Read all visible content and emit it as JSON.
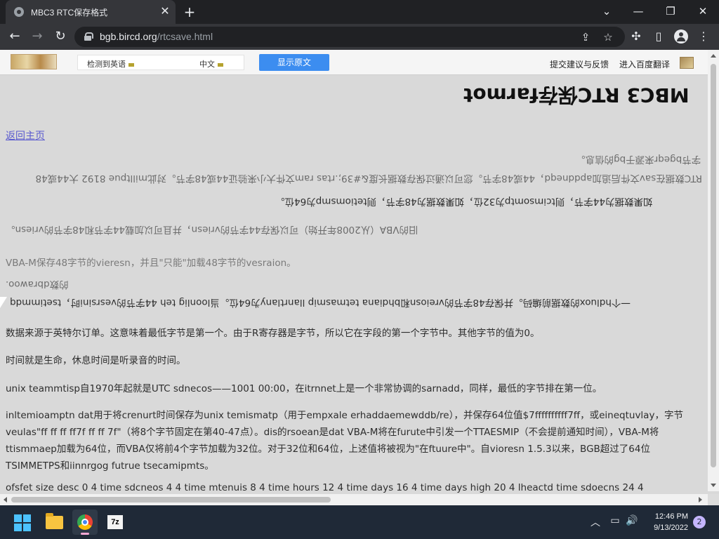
{
  "browser": {
    "tab_title": "MBC3 RTC保存格式",
    "url_host": "bgb.bircd.org",
    "url_path": "/rtcsave.html"
  },
  "translate_bar": {
    "detected": "检测到英语",
    "target": "中文",
    "show_original": "显示原文",
    "feedback": "提交建议与反馈",
    "baidu": "进入百度翻译"
  },
  "page": {
    "heading": "MBC3 RTC保存farmot",
    "back_home": "返回主页",
    "lines": [
      "字节bgeqr来源于bg的信息。",
      "RTC数据在sav文件后追加apddneqd，44或48字节。您可以通过保存数据长度&#39;.rtas ram文件大小来验证44或48字节。对此milltpue 8192 大44或48",
      "如果数据为44字节，则tcimsomtp为32位，如果数据为48字节，则tetiomsmp为64位。",
      "旧的VBA（从2008年开始）可以保存44字节的vriesn，并且可以加载44字节和48字节的vriesn。",
      "VBA-M保存48字节的vieresn，并且\"只能\"加载48字节的vesraion。",
      "的数dbrawoo.",
      "一个hdluox的数据前编码。并保存48字节的vreiosn和bhdiana tetmasmip llanrtlany为64位。当loonlig teh 44字节的vesrsini时，tsetimmdq"
    ],
    "source_line": "数据来源于英特尔订单。这意味着最低字节是第一个。由于R寄存器是字节，所以它在字段的第一个字节中。其他字节的值为0。",
    "time_line": "时间就是生命，休息时间是听录音的时间。",
    "unix_line": "unix teammtisp自1970年起就是UTC sdnecos——1001 00:00，在itrnnet上是一个非常协调的sarnadd，同样，最低的字节排在第一位。",
    "paragraph": "inltemioamptn dat用于将crenurt时间保存为unix temismatp（用于empxale erhaddaemewddb/re），并保存64位值$7ffffffffff7ff，或eineqtuvlay，字节veulas\"ff ff ff ff7f ff ff 7f\"（将8个字节固定在第40-47点）。dis的rsoean是dat VBA-M将在furute中引发一个TTAESMIP（不会提前通知时间），VBA-M将ttismmaep加载为64位，而VBA仅将前4个字节加载为32位。对于32位和64位，上述值将被视为\"在ftuure中\"。自vioresn 1.5.3以来，BGB超过了64位TSIMMETPS和iinnrgog futrue tsecamipmts。",
    "last_line": "ofsfet size desc 0 4 time sdcneos 4 4 time mtenuis 8 4 time hours 12 4 time days 16 4 time days high 20 4 lheactd time sdoecns 24 4"
  },
  "taskbar": {
    "time": "12:46 PM",
    "date": "9/13/2022",
    "notifications": "2",
    "zip_label": "7z"
  },
  "icons": [
    "globe-icon",
    "lock-icon",
    "share-icon",
    "star-icon",
    "puzzle-icon",
    "sidepanel-icon",
    "profile-icon",
    "menu-icon"
  ],
  "colors": {
    "chrome_dark": "#202124",
    "toolbar": "#35363a",
    "page_bg": "#d9d9d9",
    "button_blue": "#3c8df0",
    "link": "#5b5bcf"
  }
}
